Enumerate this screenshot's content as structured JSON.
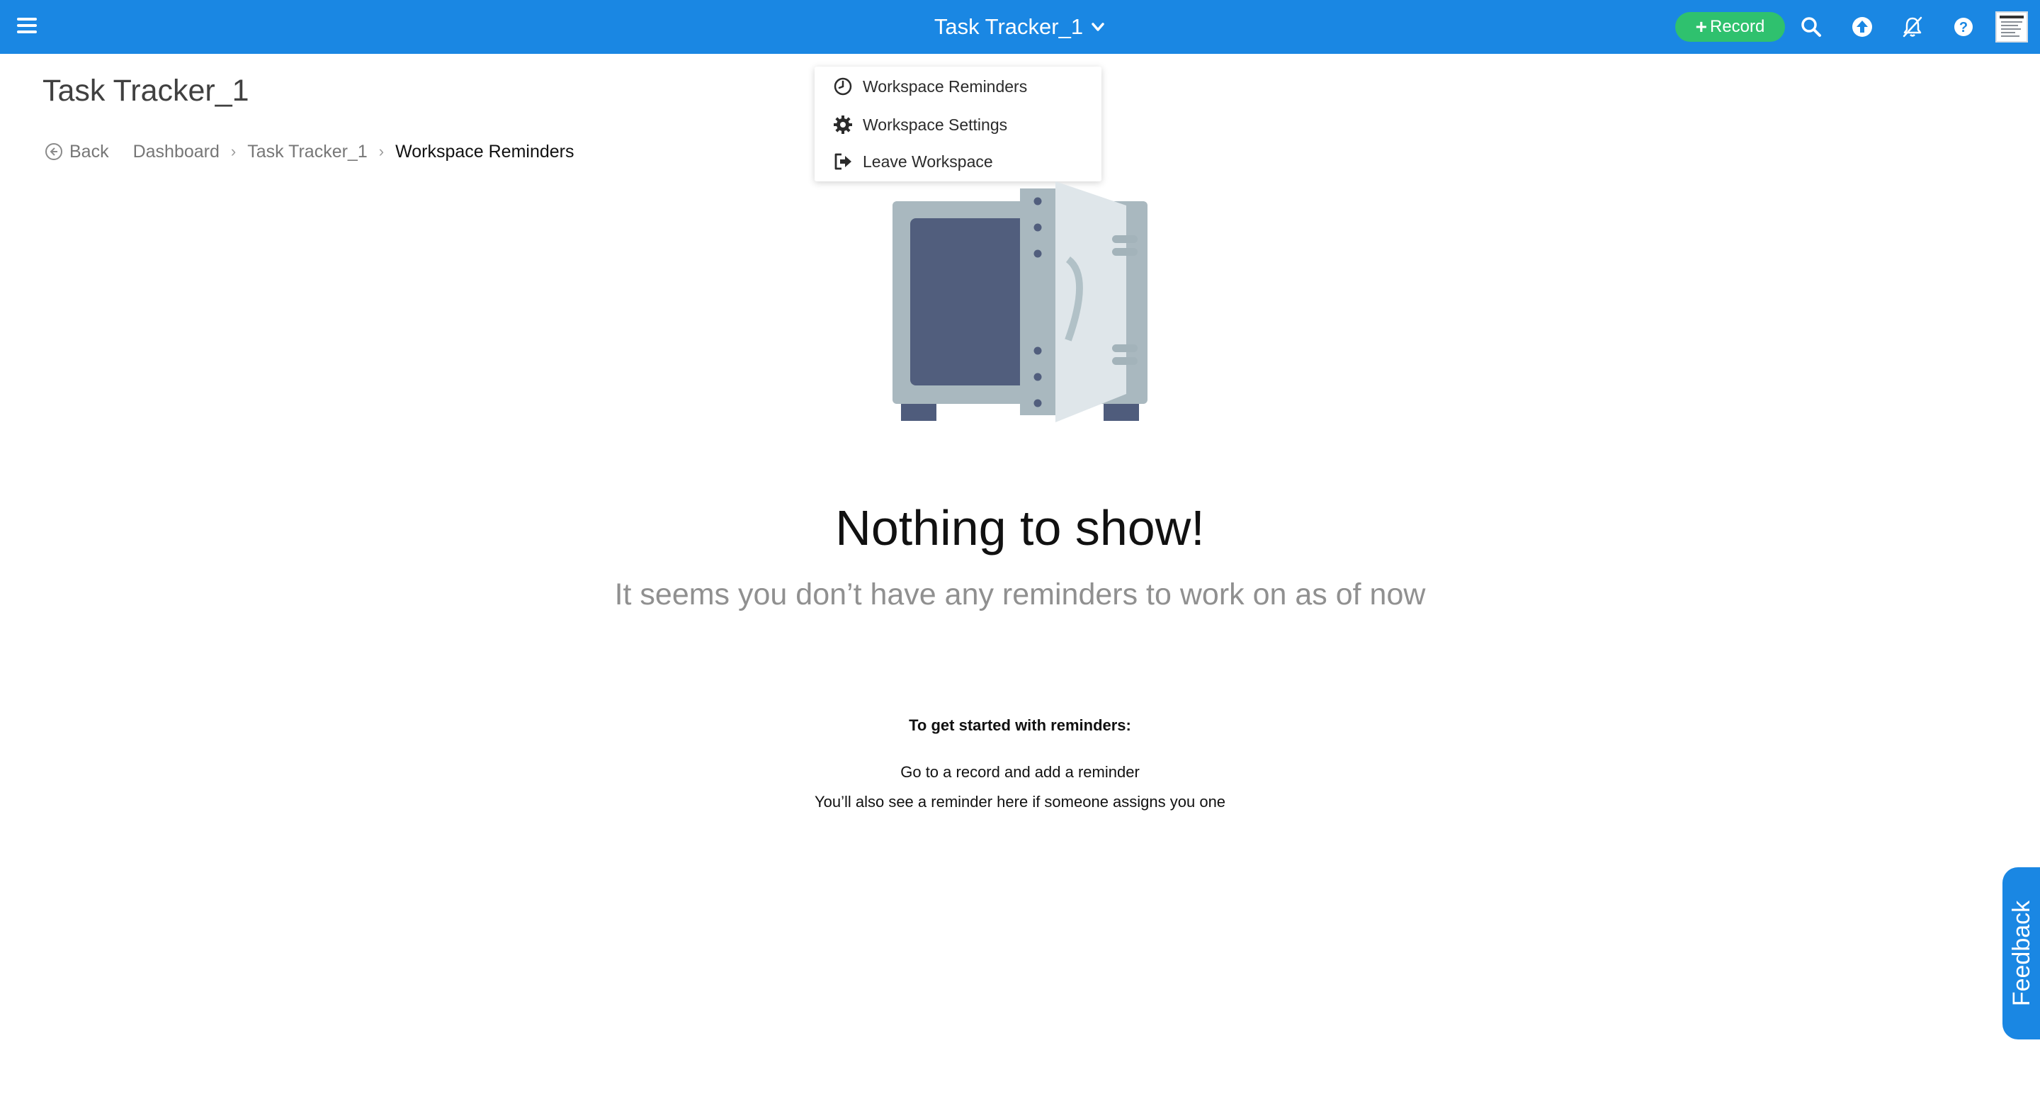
{
  "header": {
    "app_title": "Task Tracker_1",
    "record_button": "Record",
    "icons": [
      "menu-icon",
      "chevron-down-icon",
      "search-icon",
      "upload-icon",
      "notifications-off-icon",
      "help-icon",
      "avatar"
    ],
    "brand_color": "#1a87e3",
    "record_color": "#2fc16e"
  },
  "workspace_menu": {
    "items": [
      {
        "label": "Workspace Reminders",
        "icon": "clock-icon"
      },
      {
        "label": "Workspace Settings",
        "icon": "gear-icon"
      },
      {
        "label": "Leave Workspace",
        "icon": "exit-icon"
      }
    ]
  },
  "page": {
    "title": "Task Tracker_1"
  },
  "breadcrumb": {
    "back": "Back",
    "items": [
      "Dashboard",
      "Task Tracker_1",
      "Workspace Reminders"
    ]
  },
  "empty_state": {
    "illustration": "open-safe-illustration",
    "title": "Nothing to show!",
    "subtitle": "It seems you don’t have any reminders to work on as of now",
    "get_started_heading": "To get started with reminders:",
    "get_started_lines": [
      "Go to a record and add a reminder",
      "You’ll also see a reminder here if someone assigns you one"
    ]
  },
  "feedback": {
    "label": "Feedback"
  }
}
